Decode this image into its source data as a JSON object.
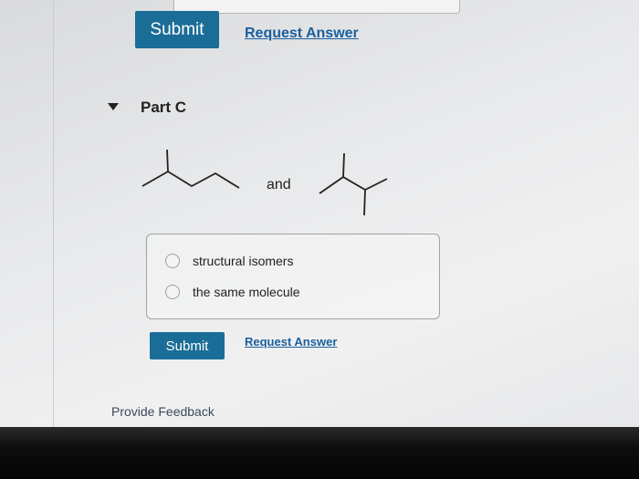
{
  "top": {
    "submit_label": "Submit",
    "request_label": "Request Answer"
  },
  "part": {
    "title": "Part C",
    "connector": "and",
    "molecules": [
      "2-methylpentane-skeletal",
      "2,3-dimethylbutane-skeletal"
    ],
    "options": [
      {
        "label": "structural isomers",
        "selected": false
      },
      {
        "label": "the same molecule",
        "selected": false
      }
    ],
    "submit_label": "Submit",
    "request_label": "Request Answer"
  },
  "footer": {
    "feedback_label": "Provide Feedback"
  },
  "colors": {
    "accent": "#1a6d96",
    "link": "#1a5f9e"
  }
}
